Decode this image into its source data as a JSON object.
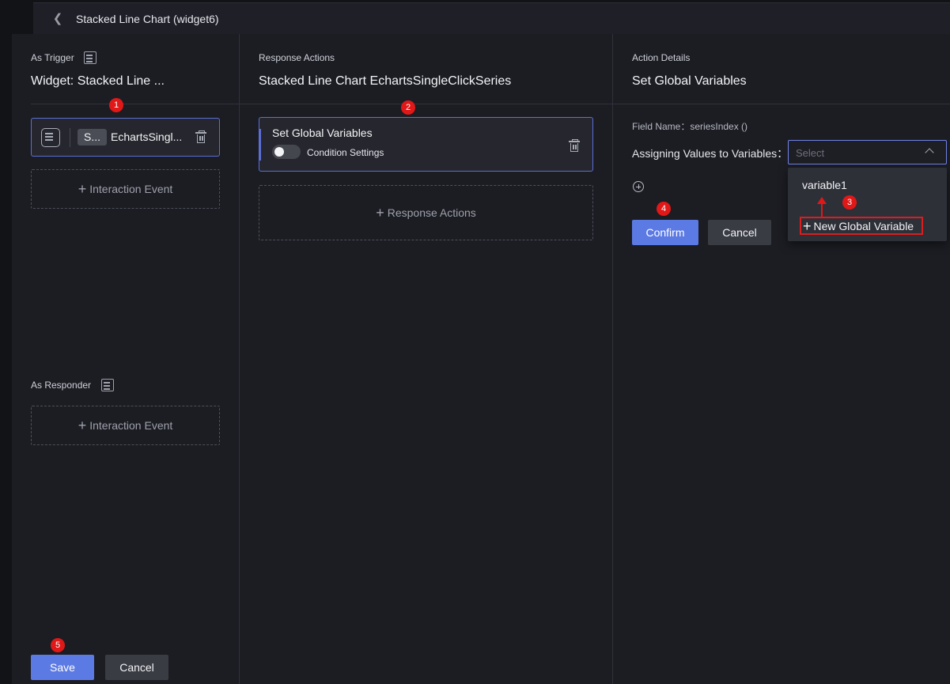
{
  "topbar": {
    "title": "Stacked Line Chart (widget6)"
  },
  "trigger": {
    "section_label": "As Trigger",
    "title": "Widget: Stacked Line ...",
    "card": {
      "badge": "S...",
      "name": "EchartsSingl..."
    },
    "add_event": "Interaction Event"
  },
  "responder": {
    "section_label": "As Responder",
    "add_event": "Interaction Event"
  },
  "response": {
    "section_label": "Response Actions",
    "title": "Stacked Line Chart EchartsSingleClickSeries",
    "card": {
      "title": "Set Global Variables",
      "toggle_label": "Condition Settings",
      "toggle_on": false
    },
    "add_action": "Response Actions"
  },
  "details": {
    "section_label": "Action Details",
    "title": "Set Global Variables",
    "field_name": "Field Name：seriesIndex ()",
    "assign_label": "Assigning Values to Variables：",
    "select_placeholder": "Select",
    "dropdown": {
      "options": [
        "variable1"
      ],
      "new_label": "New Global Variable"
    },
    "confirm_label": "Confirm",
    "cancel_label": "Cancel"
  },
  "footer": {
    "save_label": "Save",
    "cancel_label": "Cancel"
  },
  "markers": [
    "1",
    "2",
    "3",
    "4",
    "5"
  ],
  "colors": {
    "accent": "#5b7ae4",
    "marker": "#e01818",
    "background": "#1c1d23"
  }
}
